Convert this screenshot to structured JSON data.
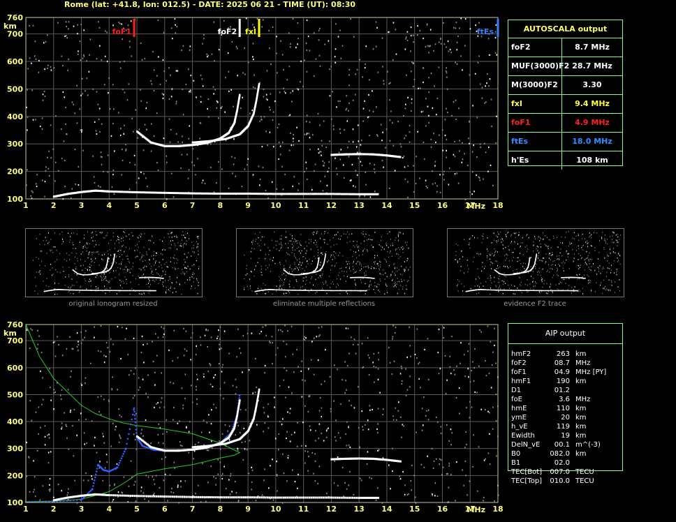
{
  "title": "Rome (lat: +41.8, lon: 012.5) - DATE: 2025 06 21 - TIME (UT): 08:30",
  "axis": {
    "x_ticks": [
      "1",
      "2",
      "3",
      "4",
      "5",
      "6",
      "7",
      "8",
      "9",
      "10",
      "11",
      "12",
      "13",
      "14",
      "15",
      "16",
      "17",
      "18"
    ],
    "y_ticks": [
      "100",
      "200",
      "300",
      "400",
      "500",
      "600",
      "700",
      "760"
    ],
    "x_unit": "MHz",
    "y_unit": "km"
  },
  "markers": [
    {
      "label": "foF1",
      "freq": 4.9,
      "color": "#ff2020"
    },
    {
      "label": "foF2",
      "freq": 8.7,
      "color": "#ffffff"
    },
    {
      "label": "fxI",
      "freq": 9.4,
      "color": "#ffff00"
    },
    {
      "label": "ftEs",
      "freq": 18.0,
      "color": "#3080ff"
    }
  ],
  "autoscala": {
    "header": "AUTOSCALA output",
    "rows": [
      {
        "key": "foF2",
        "value": "8.7 MHz",
        "color": "#ffffff"
      },
      {
        "key": "MUF(3000)F2",
        "value": "28.7 MHz",
        "color": "#ffffff"
      },
      {
        "key": "M(3000)F2",
        "value": "3.30",
        "color": "#ffffff"
      },
      {
        "key": "fxI",
        "value": "9.4 MHz",
        "color": "#ffff40"
      },
      {
        "key": "foF1",
        "value": "4.9 MHz",
        "color": "#ff2020"
      },
      {
        "key": "ftEs",
        "value": "18.0 MHz",
        "color": "#3090ff"
      },
      {
        "key": "h'Es",
        "value": "108    km",
        "color": "#ffffff"
      }
    ]
  },
  "thumbnails": [
    {
      "caption": "original ionogram resized"
    },
    {
      "caption": "eliminate multiple reflections"
    },
    {
      "caption": "evidence F2 trace"
    }
  ],
  "aip": {
    "header": "AIP output",
    "rows": [
      {
        "k": "hmF2",
        "v": "263",
        "u": "km"
      },
      {
        "k": "foF2",
        "v": "08.7",
        "u": "MHz"
      },
      {
        "k": "foF1",
        "v": "04.9",
        "u": "MHz   [PY]"
      },
      {
        "k": "hmF1",
        "v": "190",
        "u": "km"
      },
      {
        "k": "D1",
        "v": "01.2",
        "u": ""
      },
      {
        "k": "foE",
        "v": "3.6",
        "u": "MHz"
      },
      {
        "k": "hmE",
        "v": "110",
        "u": "km"
      },
      {
        "k": "ymE",
        "v": "20",
        "u": "km"
      },
      {
        "k": "h_vE",
        "v": "119",
        "u": "km"
      },
      {
        "k": "Ewidth",
        "v": "19",
        "u": "km"
      },
      {
        "k": "DelN_vE",
        "v": "00.1",
        "u": "m^(-3)"
      },
      {
        "k": "B0",
        "v": "082.0",
        "u": "km"
      },
      {
        "k": "B1",
        "v": "02.0",
        "u": ""
      },
      {
        "k": "TEC[Bot]",
        "v": "007.0",
        "u": "TECU"
      },
      {
        "k": "TEC[Top]",
        "v": "010.0",
        "u": "TECU"
      }
    ]
  },
  "chart_data": [
    {
      "type": "scatter",
      "name_in_image": "ionogram",
      "xlim": [
        1,
        18
      ],
      "ylim": [
        100,
        760
      ],
      "series": [
        {
          "role": "E",
          "color": "#ffffff",
          "x": [
            2.0,
            2.5,
            3.0,
            3.5,
            4.0,
            5.0,
            6.0,
            7.0,
            8.0,
            9.0,
            10.0,
            11.0,
            12.0,
            13.0,
            13.7
          ],
          "y": [
            108,
            118,
            125,
            130,
            127,
            124,
            122,
            120,
            119,
            119,
            118,
            118,
            118,
            117,
            117
          ]
        },
        {
          "role": "F2_o",
          "color": "#ffffff",
          "x": [
            5.0,
            5.5,
            6.0,
            6.5,
            7.0,
            7.5,
            8.0,
            8.3,
            8.5,
            8.6,
            8.7
          ],
          "y": [
            345,
            305,
            292,
            292,
            296,
            303,
            320,
            340,
            375,
            420,
            480
          ]
        },
        {
          "role": "F2_x",
          "color": "#ffffff",
          "x": [
            7.0,
            7.6,
            8.2,
            8.7,
            9.0,
            9.2,
            9.3,
            9.4
          ],
          "y": [
            305,
            310,
            318,
            335,
            365,
            410,
            460,
            520
          ]
        },
        {
          "role": "Es",
          "color": "#ffffff",
          "x": [
            12.0,
            12.5,
            13.0,
            13.5,
            14.0,
            14.5
          ],
          "y": [
            260,
            262,
            263,
            262,
            258,
            252
          ]
        }
      ]
    },
    {
      "type": "line",
      "name_in_image": "AIP fit",
      "xlim": [
        1,
        18
      ],
      "ylim": [
        100,
        760
      ],
      "series": [
        {
          "role": "profile",
          "color": "#20d020",
          "x": [
            1.0,
            1.5,
            2.0,
            3.0,
            3.5,
            4.0,
            4.5,
            5.0,
            6.0,
            7.0,
            8.0,
            8.7,
            8.5,
            8.0,
            7.0,
            6.0,
            5.0,
            4.8,
            4.5,
            4.0,
            3.5,
            3.2,
            3.0,
            2.0,
            1.0
          ],
          "y": [
            760,
            640,
            560,
            460,
            430,
            410,
            395,
            385,
            372,
            355,
            320,
            285,
            275,
            265,
            240,
            225,
            205,
            190,
            170,
            140,
            125,
            118,
            112,
            105,
            102
          ]
        },
        {
          "role": "virtual",
          "color": "#3060ff",
          "x": [
            1.0,
            2.0,
            3.0,
            3.4,
            3.6,
            3.8,
            4.0,
            4.3,
            4.6,
            4.9,
            5.0,
            5.2,
            5.6,
            6.0,
            7.0,
            8.0,
            8.4,
            8.6,
            8.7
          ],
          "y": [
            102,
            104,
            110,
            150,
            240,
            220,
            215,
            230,
            300,
            450,
            340,
            310,
            295,
            292,
            296,
            320,
            360,
            420,
            500
          ]
        }
      ]
    }
  ]
}
